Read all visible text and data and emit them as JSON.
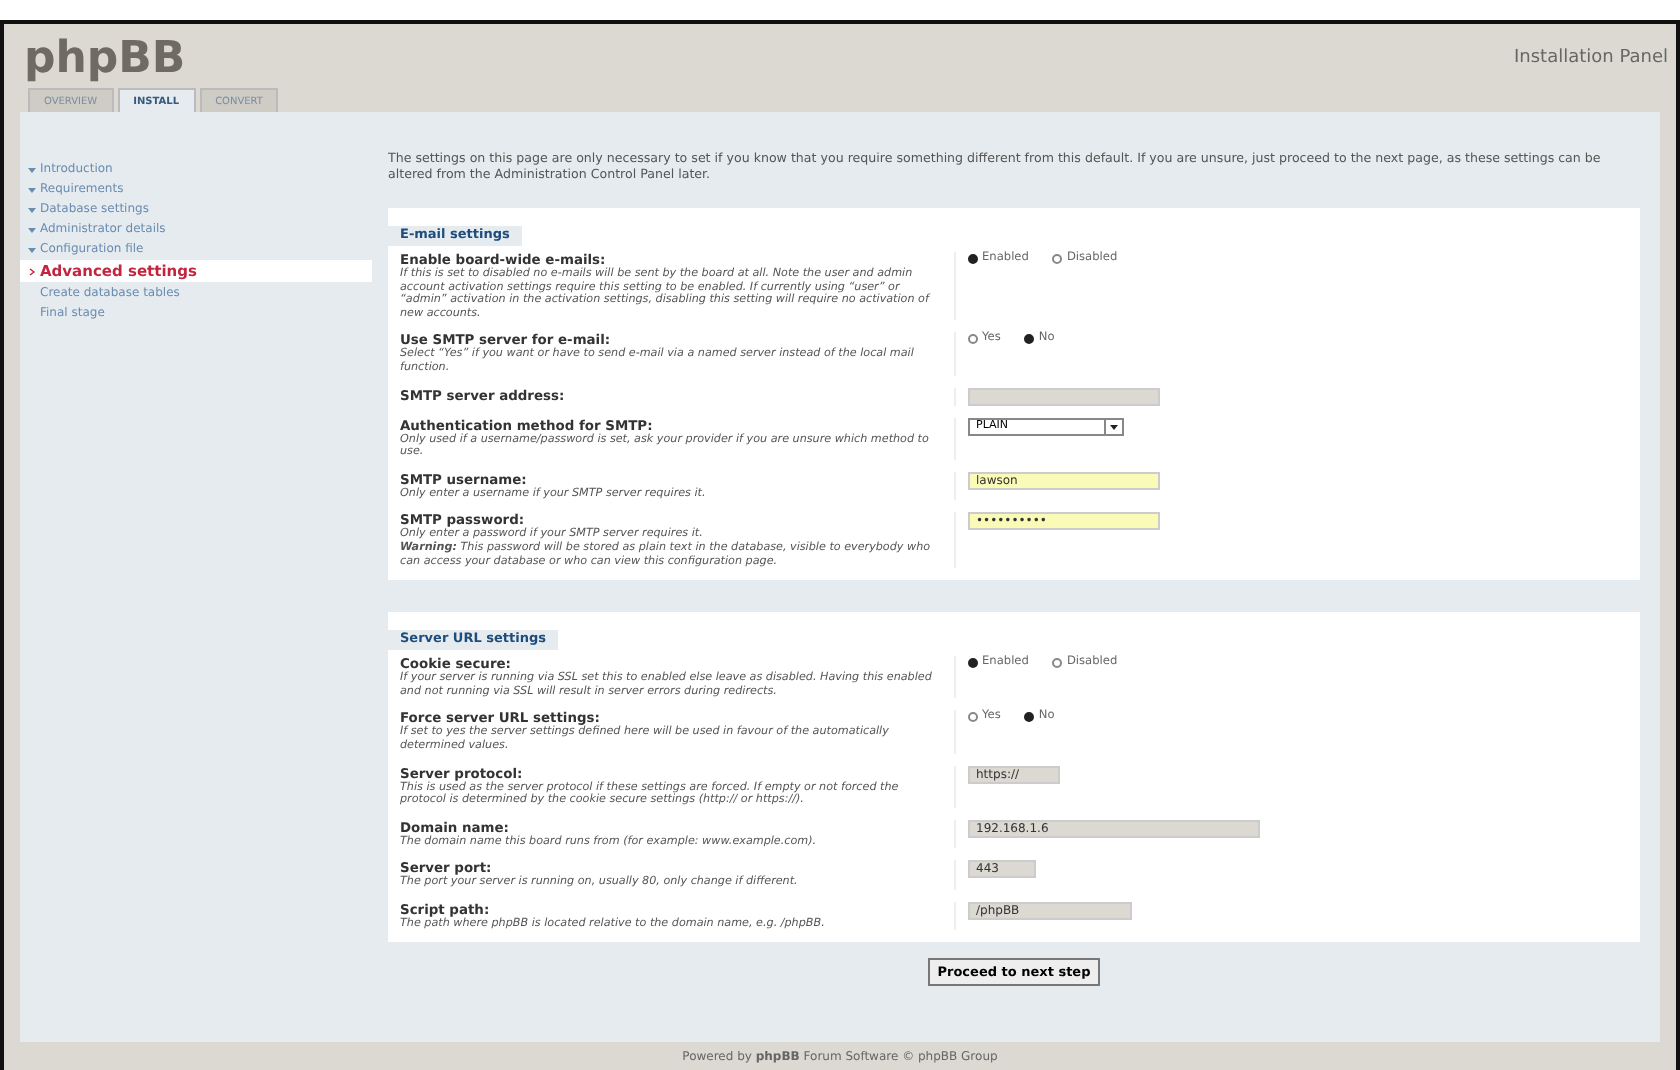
{
  "header": {
    "logo": "phpBB",
    "title": "Installation Panel"
  },
  "tabs": [
    {
      "label": "OVERVIEW",
      "selected": false
    },
    {
      "label": "INSTALL",
      "selected": true
    },
    {
      "label": "CONVERT",
      "selected": false
    }
  ],
  "sidebar": {
    "items": [
      {
        "label": "Introduction",
        "done": true,
        "selected": false
      },
      {
        "label": "Requirements",
        "done": true,
        "selected": false
      },
      {
        "label": "Database settings",
        "done": true,
        "selected": false
      },
      {
        "label": "Administrator details",
        "done": true,
        "selected": false
      },
      {
        "label": "Configuration file",
        "done": true,
        "selected": false
      },
      {
        "label": "Advanced settings",
        "done": false,
        "selected": true
      },
      {
        "label": "Create database tables",
        "done": false,
        "selected": false
      },
      {
        "label": "Final stage",
        "done": false,
        "selected": false
      }
    ]
  },
  "intro": "The settings on this page are only necessary to set if you know that you require something different from this default. If you are unsure, just proceed to the next page, as these settings can be altered from the Administration Control Panel later.",
  "sections": [
    {
      "legend": "E-mail settings",
      "rows": [
        {
          "kind": "radio",
          "label": "Enable board-wide e-mails:",
          "description": "If this is set to disabled no e-mails will be sent by the board at all. Note the user and admin account activation settings require this setting to be enabled. If currently using “user” or “admin” activation in the activation settings, disabling this setting will require no activation of new accounts.",
          "options": [
            {
              "label": "Enabled",
              "selected": true
            },
            {
              "label": "Disabled",
              "selected": false
            }
          ]
        },
        {
          "kind": "radio",
          "label": "Use SMTP server for e-mail:",
          "description": "Select “Yes” if you want or have to send e-mail via a named server instead of the local mail function.",
          "options": [
            {
              "label": "Yes",
              "selected": false
            },
            {
              "label": "No",
              "selected": true
            }
          ]
        },
        {
          "kind": "text",
          "label": "SMTP server address:",
          "highlighted": false
        },
        {
          "kind": "select",
          "label": "Authentication method for SMTP:",
          "description": "Only used if a username/password is set, ask your provider if you are unsure which method to use.",
          "value": "PLAIN"
        },
        {
          "kind": "text",
          "label": "SMTP username:",
          "description": "Only enter a username if your SMTP server requires it.",
          "value": "lawson",
          "highlighted": true
        },
        {
          "kind": "text",
          "label": "SMTP password:",
          "description": "Only enter a password if your SMTP server requires it.\n**Warning:** This password will be stored as plain text in the database, visible to everybody who can access your database or who can view this configuration page.",
          "value": "••••••••••",
          "highlighted": true
        }
      ]
    },
    {
      "legend": "Server URL settings",
      "rows": [
        {
          "kind": "radio",
          "label": "Cookie secure:",
          "description": "If your server is running via SSL set this to enabled else leave as disabled. Having this enabled and not running via SSL will result in server errors during redirects.",
          "options": [
            {
              "label": "Enabled",
              "selected": true
            },
            {
              "label": "Disabled",
              "selected": false
            }
          ]
        },
        {
          "kind": "radio",
          "label": "Force server URL settings:",
          "description": "If set to yes the server settings defined here will be used in favour of the automatically determined values.",
          "options": [
            {
              "label": "Yes",
              "selected": false
            },
            {
              "label": "No",
              "selected": true
            }
          ]
        },
        {
          "kind": "text",
          "label": "Server protocol:",
          "description": "This is used as the server protocol if these settings are forced. If empty or not forced the protocol is determined by the cookie secure settings (http:// or https://).",
          "value": "https://",
          "highlighted": false
        },
        {
          "kind": "text",
          "label": "Domain name:",
          "description": "The domain name this board runs from (for example: www.example.com).",
          "value": "192.168.1.6",
          "highlighted": false
        },
        {
          "kind": "text",
          "label": "Server port:",
          "description": "The port your server is running on, usually 80, only change if different.",
          "value": "443",
          "highlighted": false
        },
        {
          "kind": "text",
          "label": "Script path:",
          "description": "The path where phpBB is located relative to the domain name, e.g. /phpBB.",
          "value": "/phpBB",
          "highlighted": false
        }
      ]
    }
  ],
  "submit": "Proceed to next step",
  "footer": "Powered by **phpBB** Forum Software © phpBB Group"
}
